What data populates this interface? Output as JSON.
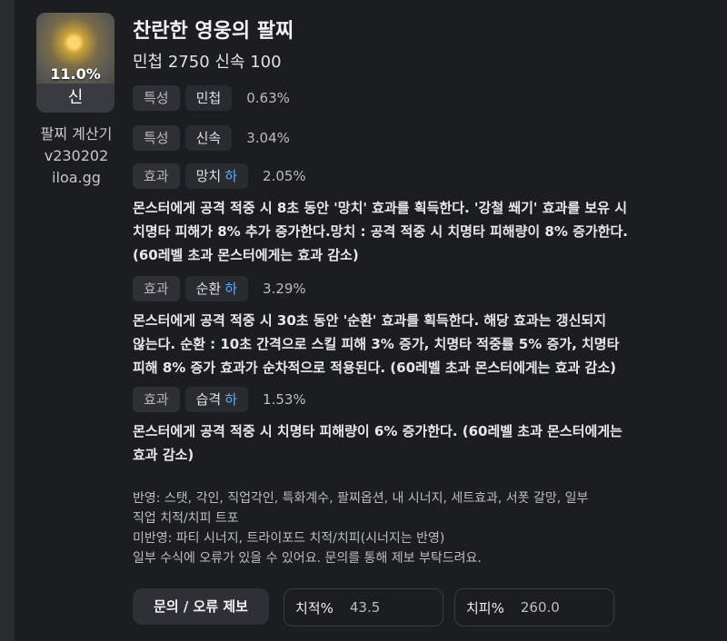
{
  "item": {
    "rate": "11.0%",
    "grade": "신",
    "title": "찬란한 영웅의 팔찌",
    "subtitle": "민첩 2750  신속 100"
  },
  "calculator": {
    "name": "팔찌 계산기",
    "version": "v230202",
    "site": "iloa.gg"
  },
  "rows": [
    {
      "type": "특성",
      "name": "민첩",
      "tier": "",
      "pct": "0.63%"
    },
    {
      "type": "특성",
      "name": "신속",
      "tier": "",
      "pct": "3.04%"
    },
    {
      "type": "효과",
      "name": "망치",
      "tier": "하",
      "pct": "2.05%",
      "desc": [
        "몬스터에게 공격 적중 시 8초 동안 '망치' 효과를 획득한다. '강철 쐐기' 효과를 보유 시",
        "치명타 피해가 8% 추가 증가한다.망치 : 공격 적중 시 치명타 피해량이 8% 증가한다.",
        "(60레벨 초과 몬스터에게는 효과 감소)"
      ]
    },
    {
      "type": "효과",
      "name": "순환",
      "tier": "하",
      "pct": "3.29%",
      "desc": [
        "몬스터에게 공격 적중 시 30초 동안 '순환' 효과를 획득한다. 해당 효과는 갱신되지",
        "않는다. 순환 : 10초 간격으로 스킬 피해 3% 증가, 치명타 적중률 5% 증가, 치명타",
        "피해 8% 증가 효과가 순차적으로 적용된다. (60레벨 초과 몬스터에게는 효과 감소)"
      ]
    },
    {
      "type": "효과",
      "name": "습격",
      "tier": "하",
      "pct": "1.53%",
      "desc": [
        "몬스터에게 공격 적중 시 치명타 피해량이 6% 증가한다. (60레벨 초과 몬스터에게는",
        "효과 감소)"
      ]
    }
  ],
  "notes": [
    "반영: 스탯, 각인, 직업각인, 특화계수, 팔찌옵션, 내 시너지, 세트효과, 서폿 갈망, 일부",
    "직업 치적/치피 트포",
    "미반영: 파티 시너지, 트라이포드 치적/치피(시너지는 반영)",
    "일부 수식에 오류가 있을 수 있어요. 문의를 통해 제보 부탁드려요."
  ],
  "actions": {
    "report_label": "문의 / 오류 제보",
    "crit_rate_label": "치적%",
    "crit_rate_value": "43.5",
    "crit_dmg_label": "치피%",
    "crit_dmg_value": "260.0"
  },
  "colors": {
    "accent": "#5aaeff",
    "background": "#1c1d20"
  }
}
